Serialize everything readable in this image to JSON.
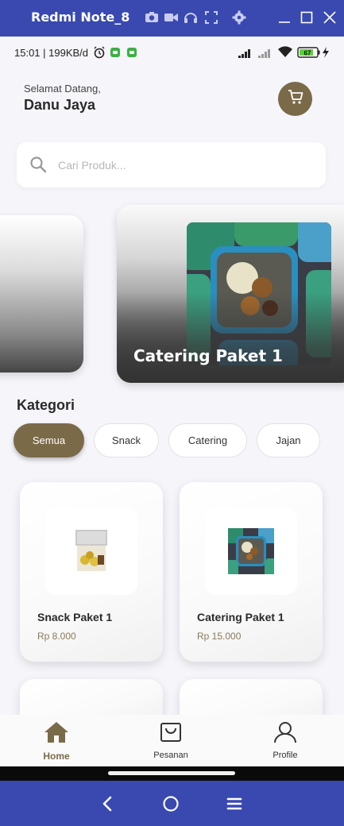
{
  "window": {
    "title": "Redmi Note_8",
    "icons": [
      "camera-icon",
      "video-icon",
      "headphones-icon",
      "fullscreen-icon",
      "settings-icon",
      "minimize-icon",
      "maximize-icon",
      "close-icon"
    ]
  },
  "status_bar": {
    "time_text": "15:01 | 199KB/d",
    "battery": "67",
    "icons": [
      "alarm-icon",
      "app-notification-icon",
      "signal-icon",
      "wifi-icon",
      "battery-icon",
      "charging-icon"
    ]
  },
  "header": {
    "greeting": "Selamat Datang,",
    "user_name": "Danu Jaya",
    "cart_icon": "cart-icon"
  },
  "search": {
    "placeholder": "Cari Produk...",
    "value": ""
  },
  "carousel": {
    "items": [
      {
        "title": ""
      },
      {
        "title": "Catering Paket 1"
      }
    ]
  },
  "categories": {
    "title": "Kategori",
    "items": [
      {
        "label": "Semua",
        "active": true
      },
      {
        "label": "Snack",
        "active": false
      },
      {
        "label": "Catering",
        "active": false
      },
      {
        "label": "Jajan",
        "active": false
      }
    ]
  },
  "products": [
    {
      "name": "Snack Paket 1",
      "price": "Rp 8.000"
    },
    {
      "name": "Catering Paket 1",
      "price": "Rp 15.000"
    }
  ],
  "bottom_nav": [
    {
      "label": "Home",
      "icon": "home-icon",
      "active": true
    },
    {
      "label": "Pesanan",
      "icon": "shopping-bag-icon",
      "active": false
    },
    {
      "label": "Profile",
      "icon": "profile-icon",
      "active": false
    }
  ],
  "colors": {
    "accent": "#7a6a48",
    "emulator_frame": "#3949b0",
    "background": "#f5f5fa"
  }
}
